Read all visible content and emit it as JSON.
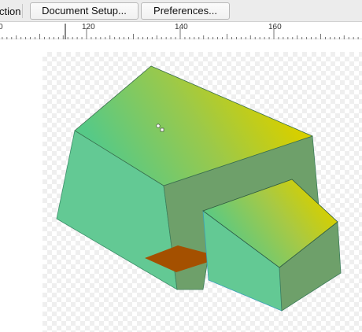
{
  "toolbar": {
    "clipped_label": "ction",
    "document_setup_label": "Document Setup...",
    "preferences_label": "Preferences..."
  },
  "ruler": {
    "labels": [
      "0",
      "120",
      "140",
      "160"
    ]
  },
  "canvas": {
    "colors": {
      "roof_green": "#56c987",
      "roof_yellow": "#d6cf00",
      "wall_light": "#63c994",
      "wall_shadow": "#6ea06a",
      "floor_orange": "#a45000"
    }
  }
}
